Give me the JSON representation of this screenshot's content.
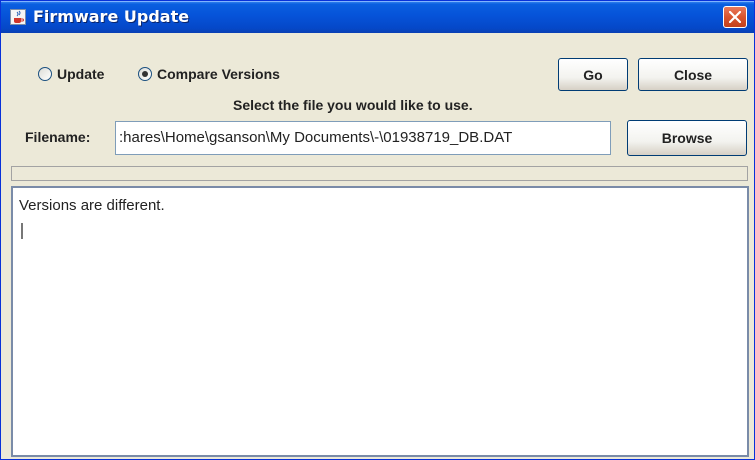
{
  "window": {
    "title": "Firmware Update",
    "icon": "java-cup-icon",
    "close_icon": "close-icon"
  },
  "mode": {
    "options": [
      {
        "label": "Update",
        "selected": false
      },
      {
        "label": "Compare Versions",
        "selected": true
      }
    ]
  },
  "actions": {
    "go_label": "Go",
    "close_label": "Close",
    "browse_label": "Browse"
  },
  "instruction": "Select the file you would like to use.",
  "file": {
    "label": "Filename:",
    "value": ":hares\\Home\\gsanson\\My Documents\\-\\01938719_DB.DAT"
  },
  "progress": {
    "value": 0
  },
  "output": {
    "text": "Versions are different."
  },
  "colors": {
    "titlebar": "#0553d9",
    "window_bg": "#ece9d8",
    "close_button": "#d9542e"
  }
}
